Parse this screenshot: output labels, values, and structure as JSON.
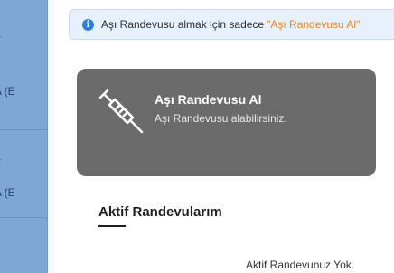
{
  "sidebar": {
    "items": [
      {
        "label": "a"
      },
      {
        "label": "A (E"
      },
      {
        "label": "a"
      },
      {
        "label": "A (E"
      }
    ]
  },
  "info_bar": {
    "text": "Aşı Randevusu almak için sadece",
    "link_text": "\"Aşı Randevusu Al\"",
    "icon": "info-icon"
  },
  "card": {
    "icon": "syringe-icon",
    "title": "Aşı Randevusu Al",
    "subtitle": "Aşı Randevusu alabilirsiniz."
  },
  "active_section": {
    "title": "Aktif Randevularım",
    "empty_text": "Aktif Randevunuz Yok."
  },
  "colors": {
    "card_bg": "#6b6b6b",
    "info_bg": "#e6f1fb",
    "link": "#e8892b",
    "info_icon": "#2a7fd8",
    "sidebar": "#7fa7d6"
  }
}
